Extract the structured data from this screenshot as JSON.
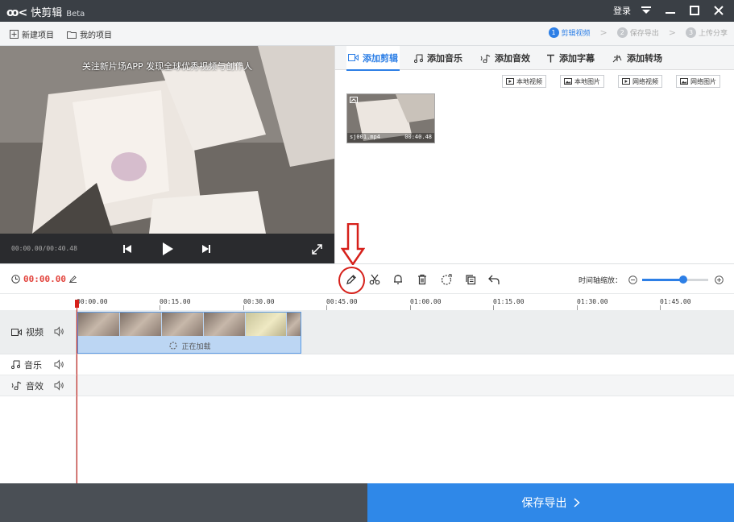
{
  "app": {
    "logo_mark": "ꝏ<",
    "name": "快剪辑",
    "badge": "Beta"
  },
  "window": {
    "login": "登录"
  },
  "menu": {
    "new_project": "新建项目",
    "my_projects": "我的项目"
  },
  "steps": [
    {
      "num": "1",
      "label": "剪辑视频"
    },
    {
      "num": "2",
      "label": "保存导出"
    },
    {
      "num": "3",
      "label": "上传分享"
    }
  ],
  "preview": {
    "subtitle": "关注新片场APP 发现全球优秀视频与创作人",
    "time": "00:00.00/00:40.48"
  },
  "tabs": [
    {
      "label": "添加剪辑"
    },
    {
      "label": "添加音乐"
    },
    {
      "label": "添加音效"
    },
    {
      "label": "添加字幕"
    },
    {
      "label": "添加转场"
    }
  ],
  "source_buttons": [
    {
      "label": "本地视频"
    },
    {
      "label": "本地图片"
    },
    {
      "label": "网络视频"
    },
    {
      "label": "网络图片"
    }
  ],
  "clip": {
    "name": "sj001.mp4",
    "duration": "00:40.48"
  },
  "toolbar": {
    "current_time": "00:00.00",
    "zoom_label": "时间轴缩放：",
    "zoom_level": 0.62
  },
  "ruler": [
    "00:00.00",
    "00:15.00",
    "00:30.00",
    "00:45.00",
    "01:00.00",
    "01:15.00",
    "01:30.00",
    "01:45.00"
  ],
  "tracks": {
    "video": "视频",
    "music": "音乐",
    "sfx": "音效"
  },
  "timeline_clip": {
    "loading": "正在加载"
  },
  "footer": {
    "export": "保存导出"
  },
  "colors": {
    "accent": "#2f88e8",
    "playhead": "#d6201a",
    "titlebar": "#3a3f45"
  }
}
